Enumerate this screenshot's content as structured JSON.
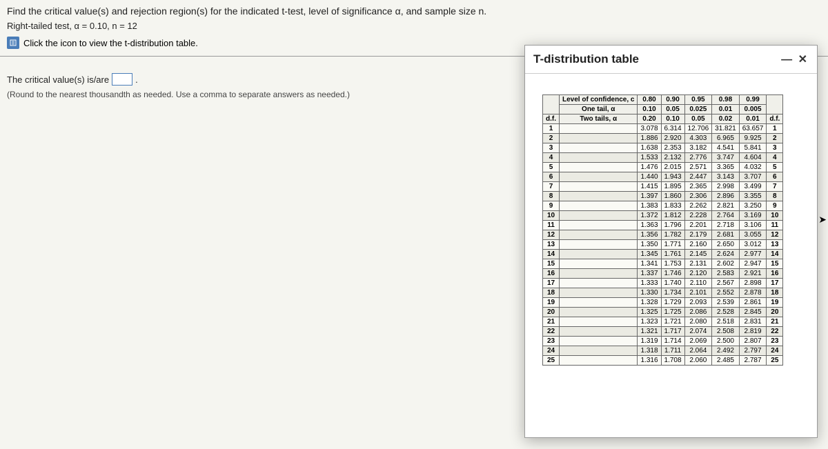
{
  "question": {
    "line1": "Find the critical value(s) and rejection region(s) for the indicated t-test, level of significance α, and sample size n.",
    "line2": "Right-tailed test, α = 0.10, n = 12",
    "iconLink": "Click the icon to view the t-distribution table."
  },
  "answer": {
    "prompt_pre": "The critical value(s) is/are",
    "prompt_post": ".",
    "hint": "(Round to the nearest thousandth as needed. Use a comma to separate answers as needed.)"
  },
  "popup": {
    "title": "T-distribution table",
    "close": "— ✕"
  },
  "chart_data": {
    "type": "table",
    "title": "T-distribution table",
    "header_rows": [
      {
        "label": "Level of confidence, c",
        "values": [
          "0.80",
          "0.90",
          "0.95",
          "0.98",
          "0.99"
        ]
      },
      {
        "label": "One tail, α",
        "values": [
          "0.10",
          "0.05",
          "0.025",
          "0.01",
          "0.005"
        ]
      },
      {
        "label": "Two tails, α",
        "values": [
          "0.20",
          "0.10",
          "0.05",
          "0.02",
          "0.01"
        ]
      }
    ],
    "df_label": "d.f.",
    "rows": [
      {
        "df": "1",
        "v": [
          "3.078",
          "6.314",
          "12.706",
          "31.821",
          "63.657"
        ]
      },
      {
        "df": "2",
        "v": [
          "1.886",
          "2.920",
          "4.303",
          "6.965",
          "9.925"
        ]
      },
      {
        "df": "3",
        "v": [
          "1.638",
          "2.353",
          "3.182",
          "4.541",
          "5.841"
        ]
      },
      {
        "df": "4",
        "v": [
          "1.533",
          "2.132",
          "2.776",
          "3.747",
          "4.604"
        ]
      },
      {
        "df": "5",
        "v": [
          "1.476",
          "2.015",
          "2.571",
          "3.365",
          "4.032"
        ]
      },
      {
        "df": "6",
        "v": [
          "1.440",
          "1.943",
          "2.447",
          "3.143",
          "3.707"
        ]
      },
      {
        "df": "7",
        "v": [
          "1.415",
          "1.895",
          "2.365",
          "2.998",
          "3.499"
        ]
      },
      {
        "df": "8",
        "v": [
          "1.397",
          "1.860",
          "2.306",
          "2.896",
          "3.355"
        ]
      },
      {
        "df": "9",
        "v": [
          "1.383",
          "1.833",
          "2.262",
          "2.821",
          "3.250"
        ]
      },
      {
        "df": "10",
        "v": [
          "1.372",
          "1.812",
          "2.228",
          "2.764",
          "3.169"
        ]
      },
      {
        "df": "11",
        "v": [
          "1.363",
          "1.796",
          "2.201",
          "2.718",
          "3.106"
        ]
      },
      {
        "df": "12",
        "v": [
          "1.356",
          "1.782",
          "2.179",
          "2.681",
          "3.055"
        ]
      },
      {
        "df": "13",
        "v": [
          "1.350",
          "1.771",
          "2.160",
          "2.650",
          "3.012"
        ]
      },
      {
        "df": "14",
        "v": [
          "1.345",
          "1.761",
          "2.145",
          "2.624",
          "2.977"
        ]
      },
      {
        "df": "15",
        "v": [
          "1.341",
          "1.753",
          "2.131",
          "2.602",
          "2.947"
        ]
      },
      {
        "df": "16",
        "v": [
          "1.337",
          "1.746",
          "2.120",
          "2.583",
          "2.921"
        ]
      },
      {
        "df": "17",
        "v": [
          "1.333",
          "1.740",
          "2.110",
          "2.567",
          "2.898"
        ]
      },
      {
        "df": "18",
        "v": [
          "1.330",
          "1.734",
          "2.101",
          "2.552",
          "2.878"
        ]
      },
      {
        "df": "19",
        "v": [
          "1.328",
          "1.729",
          "2.093",
          "2.539",
          "2.861"
        ]
      },
      {
        "df": "20",
        "v": [
          "1.325",
          "1.725",
          "2.086",
          "2.528",
          "2.845"
        ]
      },
      {
        "df": "21",
        "v": [
          "1.323",
          "1.721",
          "2.080",
          "2.518",
          "2.831"
        ]
      },
      {
        "df": "22",
        "v": [
          "1.321",
          "1.717",
          "2.074",
          "2.508",
          "2.819"
        ]
      },
      {
        "df": "23",
        "v": [
          "1.319",
          "1.714",
          "2.069",
          "2.500",
          "2.807"
        ]
      },
      {
        "df": "24",
        "v": [
          "1.318",
          "1.711",
          "2.064",
          "2.492",
          "2.797"
        ]
      },
      {
        "df": "25",
        "v": [
          "1.316",
          "1.708",
          "2.060",
          "2.485",
          "2.787"
        ]
      }
    ]
  }
}
